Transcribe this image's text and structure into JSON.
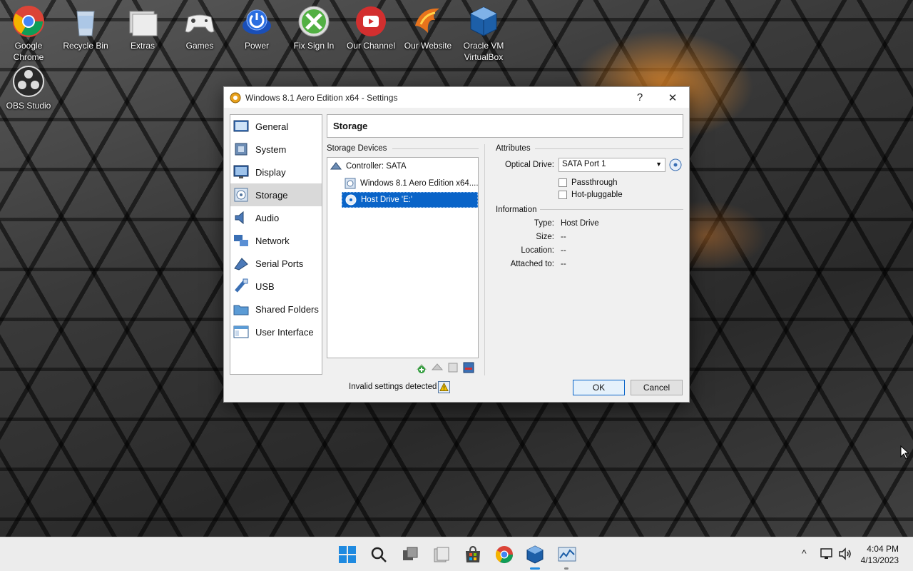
{
  "desktop": {
    "icons": [
      {
        "label": "Google Chrome",
        "icon": "chrome-icon"
      },
      {
        "label": "Recycle Bin",
        "icon": "recycle-bin-icon"
      },
      {
        "label": "Extras",
        "icon": "folder-icon"
      },
      {
        "label": "Games",
        "icon": "gamepad-icon"
      },
      {
        "label": "Power",
        "icon": "power-icon"
      },
      {
        "label": "Fix Sign In",
        "icon": "xbox-icon"
      },
      {
        "label": "Our Channel",
        "icon": "youtube-icon"
      },
      {
        "label": "Our Website",
        "icon": "phoenix-icon"
      },
      {
        "label": "Oracle VM VirtualBox",
        "icon": "virtualbox-icon"
      },
      {
        "label": "OBS Studio",
        "icon": "obs-icon"
      }
    ]
  },
  "dialog": {
    "title": "Windows 8.1 Aero Edition x64 - Settings",
    "help": "?",
    "close": "✕",
    "sidebar": [
      {
        "label": "General",
        "icon": "general-icon"
      },
      {
        "label": "System",
        "icon": "system-icon"
      },
      {
        "label": "Display",
        "icon": "display-icon"
      },
      {
        "label": "Storage",
        "icon": "storage-icon",
        "active": true
      },
      {
        "label": "Audio",
        "icon": "audio-icon"
      },
      {
        "label": "Network",
        "icon": "network-icon"
      },
      {
        "label": "Serial Ports",
        "icon": "serial-ports-icon"
      },
      {
        "label": "USB",
        "icon": "usb-icon"
      },
      {
        "label": "Shared Folders",
        "icon": "shared-folders-icon"
      },
      {
        "label": "User Interface",
        "icon": "user-interface-icon"
      }
    ],
    "page_title": "Storage",
    "storage_devices_label": "Storage Devices",
    "tree": {
      "controller": "Controller: SATA",
      "items": [
        "Windows 8.1 Aero Edition x64....",
        "Host Drive 'E:'"
      ]
    },
    "attributes": {
      "heading": "Attributes",
      "optical_drive_label": "Optical Drive:",
      "optical_drive_value": "SATA Port 1",
      "passthrough": "Passthrough",
      "hot_pluggable": "Hot-pluggable"
    },
    "information": {
      "heading": "Information",
      "rows": [
        {
          "label": "Type:",
          "value": "Host Drive"
        },
        {
          "label": "Size:",
          "value": "--"
        },
        {
          "label": "Location:",
          "value": "--"
        },
        {
          "label": "Attached to:",
          "value": "--"
        }
      ]
    },
    "status": "Invalid settings detected",
    "ok": "OK",
    "cancel": "Cancel"
  },
  "taskbar": {
    "time": "4:04 PM",
    "date": "4/13/2023",
    "tray_chevron": "^"
  }
}
